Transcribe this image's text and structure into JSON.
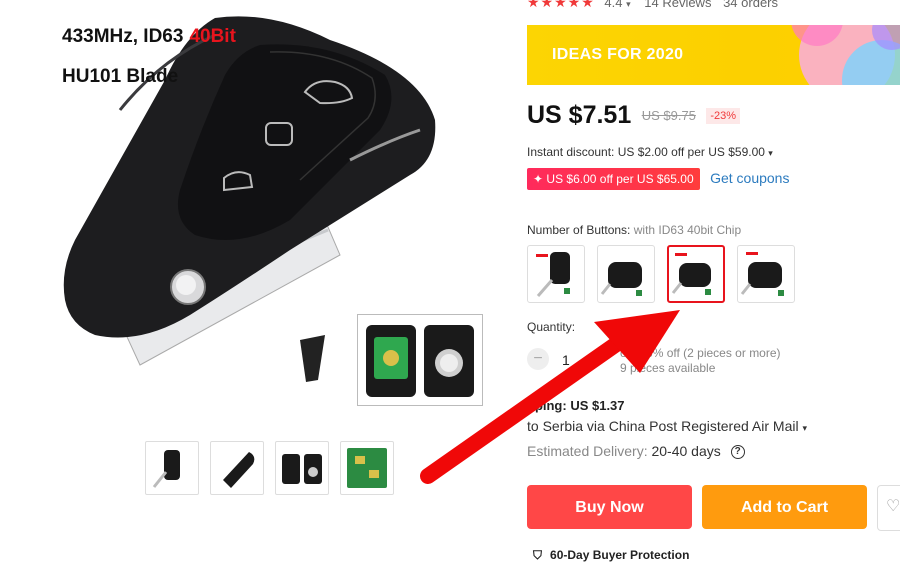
{
  "product_image": {
    "line1": "433MHz, ID63",
    "line1_highlight": "40Bit",
    "line2": "HU101 Blade"
  },
  "rating": {
    "stars": "★★★★★",
    "score": "4.4",
    "reviews": "14 Reviews",
    "orders": "34 orders"
  },
  "banner": {
    "text": "IDEAS FOR 2020"
  },
  "price": {
    "current": "US $7.51",
    "original": "US $9.75",
    "discount": "-23%"
  },
  "instant_discount": "Instant discount: US $2.00 off per US $59.00",
  "coupon": {
    "pill": "US $6.00 off per US $65.00",
    "link": "Get coupons"
  },
  "option": {
    "label": "Number of Buttons:",
    "value": "with ID63 40bit Chip",
    "selected_index": 2
  },
  "quantity": {
    "label": "Quantity:",
    "minus": "−",
    "value": "1",
    "info": "onal 6% off (2 pieces or more)",
    "available": "9 pieces available"
  },
  "shipping": {
    "title": "pping: US $1.37",
    "via": "to Serbia via China Post Registered Air Mail",
    "delivery_label": "Estimated Delivery:",
    "delivery_days": "20-40 days"
  },
  "actions": {
    "buy": "Buy Now",
    "cart": "Add to Cart"
  },
  "protection": "60-Day Buyer Protection",
  "colors": {
    "accent_red": "#e8141d",
    "buy_button": "#ff4747",
    "cart_button": "#ff9b0e",
    "banner_yellow": "#fcd503",
    "link_blue": "#2c7bbf"
  }
}
